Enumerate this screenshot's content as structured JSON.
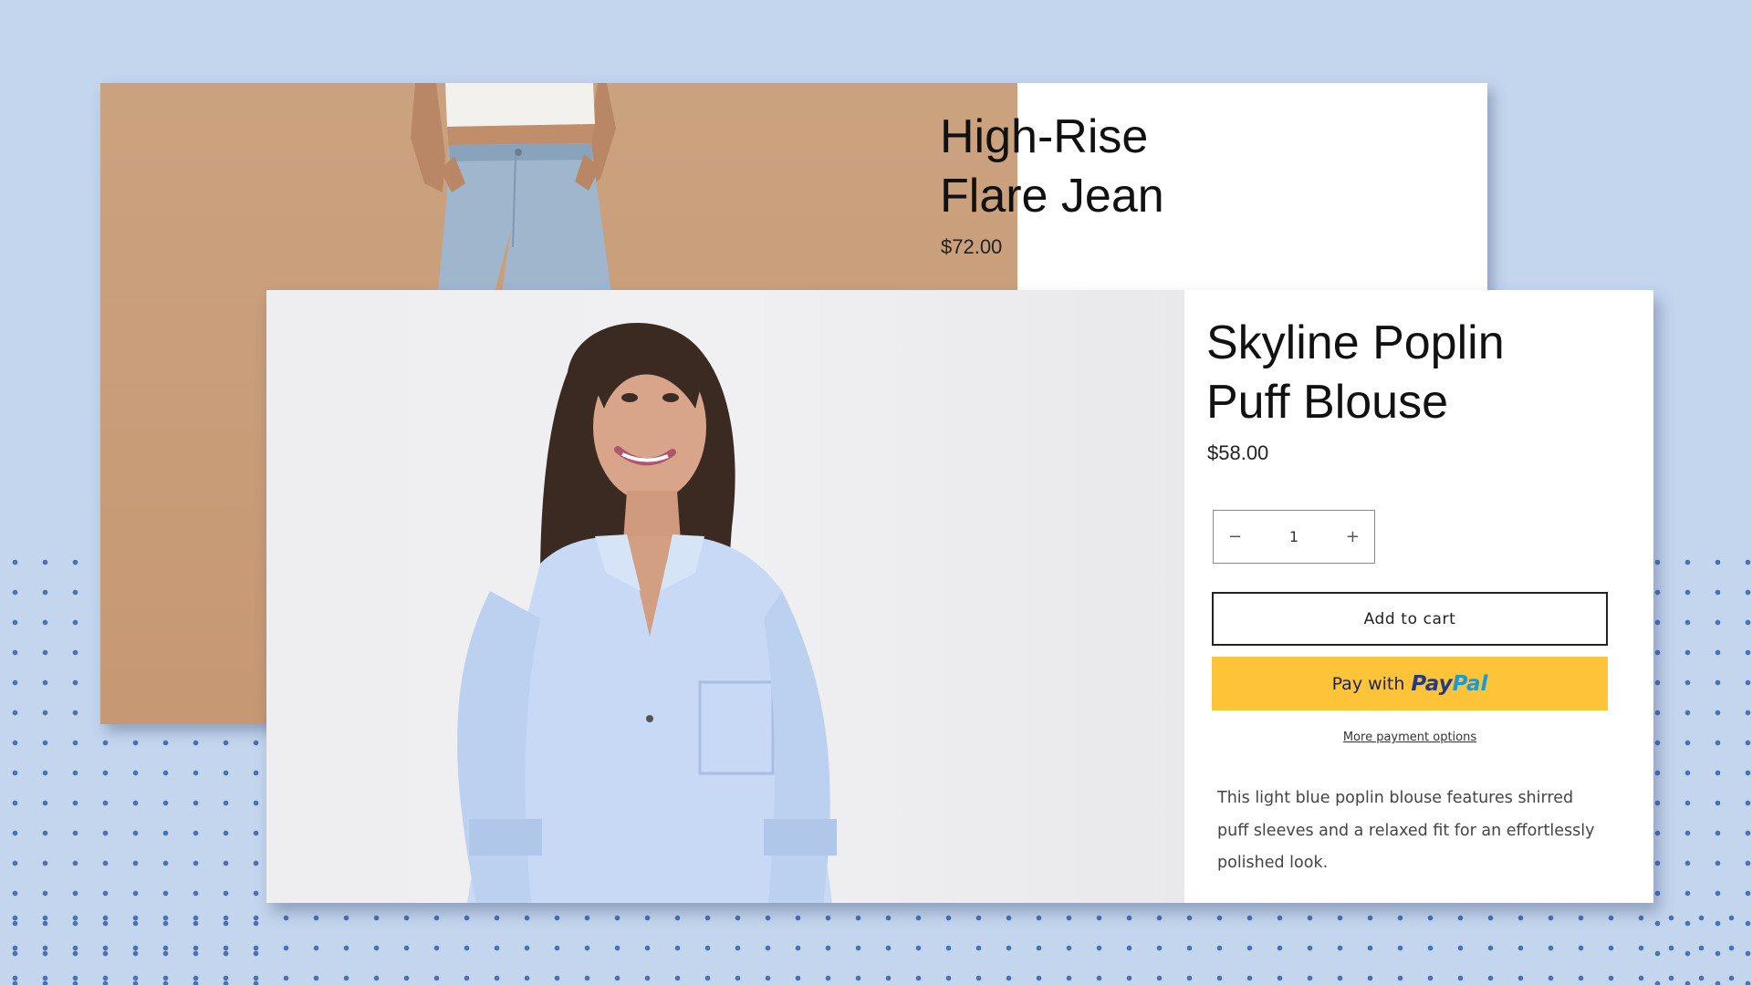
{
  "back_product": {
    "title_line1": "High-Rise",
    "title_line2": "Flare Jean",
    "price": "$72.00"
  },
  "front_product": {
    "title_line1": "Skyline Poplin",
    "title_line2": "Puff Blouse",
    "price": "$58.00",
    "quantity": {
      "decrement": "−",
      "value": "1",
      "increment": "+"
    },
    "add_to_cart": "Add to cart",
    "paypal": {
      "prefix": "Pay with",
      "brand_a": "Pay",
      "brand_b": "Pal"
    },
    "more_payment_options": "More payment options",
    "description": "This light blue poplin blouse features shirred puff sleeves and a relaxed fit for an effortlessly polished look."
  },
  "colors": {
    "background": "#c4d6ee",
    "dots": "#4a72b4",
    "paypal_button": "#fdc439",
    "back_photo_bg": "#cba27f",
    "blouse": "#c7d9f4"
  }
}
